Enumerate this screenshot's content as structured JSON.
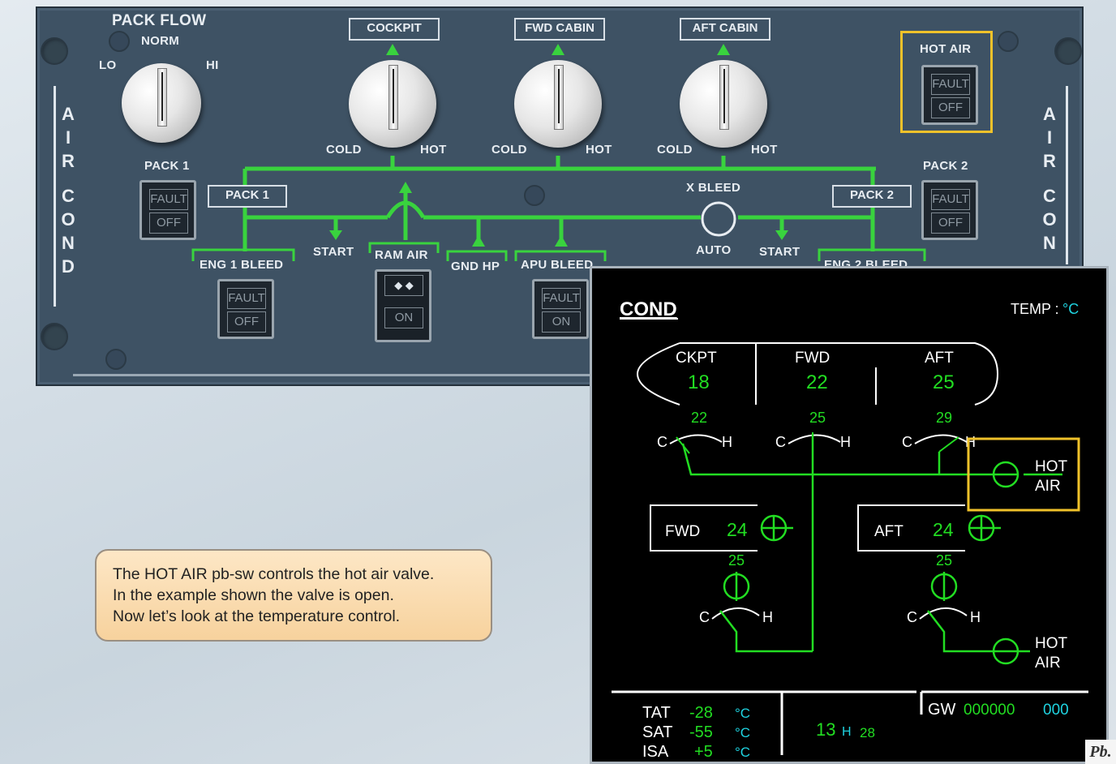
{
  "overhead_panel": {
    "side_label_left": [
      "A",
      "I",
      "R",
      "C",
      "O",
      "N",
      "D"
    ],
    "side_label_right": [
      "A",
      "I",
      "R",
      "C",
      "O",
      "N"
    ],
    "pack_flow": {
      "title": "PACK FLOW",
      "norm": "NORM",
      "lo": "LO",
      "hi": "HI"
    },
    "zones": [
      {
        "name": "COCKPIT",
        "cold": "COLD",
        "hot": "HOT"
      },
      {
        "name": "FWD CABIN",
        "cold": "COLD",
        "hot": "HOT"
      },
      {
        "name": "AFT CABIN",
        "cold": "COLD",
        "hot": "HOT"
      }
    ],
    "hot_air": {
      "title": "HOT AIR",
      "upper": "FAULT",
      "lower": "OFF"
    },
    "pack1": {
      "title": "PACK 1",
      "box": "PACK 1",
      "upper": "FAULT",
      "lower": "OFF"
    },
    "pack2": {
      "title": "PACK 2",
      "box": "PACK 2",
      "upper": "FAULT",
      "lower": "OFF"
    },
    "xbleed": {
      "title": "X BLEED",
      "mode": "AUTO"
    },
    "start_left": "START",
    "start_right": "START",
    "eng1_bleed": {
      "title": "ENG 1 BLEED",
      "upper": "FAULT",
      "lower": "OFF"
    },
    "eng2_bleed": {
      "title": "ENG 2 BLEED"
    },
    "ram_air": {
      "title": "RAM AIR",
      "lower": "ON"
    },
    "gnd_hp": "GND HP",
    "apu_bleed": {
      "title": "APU BLEED",
      "upper": "FAULT",
      "lower": "ON"
    }
  },
  "ecam": {
    "title": "COND",
    "temp_label": "TEMP : ",
    "temp_unit": "°C",
    "zones": [
      {
        "name": "CKPT",
        "temp": "18",
        "duct": "22"
      },
      {
        "name": "FWD",
        "temp": "22",
        "duct": "25"
      },
      {
        "name": "AFT",
        "temp": "25",
        "duct": "29"
      }
    ],
    "valve_c": "C",
    "valve_h": "H",
    "hot_air_label": [
      "HOT",
      "AIR"
    ],
    "cargo": [
      {
        "name": "FWD",
        "temp": "24",
        "duct": "25"
      },
      {
        "name": "AFT",
        "temp": "24",
        "duct": "25"
      }
    ],
    "bottom": {
      "tat_label": "TAT",
      "tat": "-28",
      "sat_label": "SAT",
      "sat": "-55",
      "isa_label": "ISA",
      "isa": "+5",
      "unit": "°C",
      "time_h": "13",
      "time_sep": "H",
      "time_m": "28",
      "gw_label": "GW",
      "gw_value": "000000",
      "gw_unit": "000"
    }
  },
  "note": {
    "lines": [
      "The HOT AIR pb-sw controls the hot air valve.",
      "In the example shown the valve is open.",
      "Now let’s look at the temperature control."
    ]
  },
  "logo": "Pb.",
  "colors": {
    "panel": "#3e5264",
    "duct_green": "#39d33e",
    "ecam_green": "#22dd22",
    "ecam_cyan": "#1fd3e0",
    "highlight": "#f0c22a"
  }
}
